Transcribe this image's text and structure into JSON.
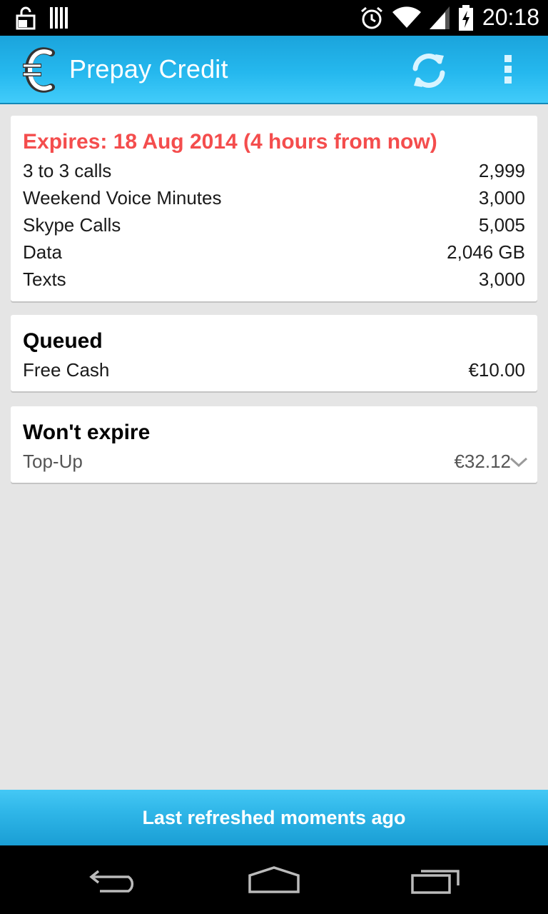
{
  "status_bar": {
    "time": "20:18",
    "icons": [
      "lock-icon",
      "barcode-icon",
      "alarm-icon",
      "wifi-icon",
      "signal-icon",
      "battery-charging-icon"
    ]
  },
  "action_bar": {
    "title": "Prepay Credit",
    "app_icon": "euro-logo-icon",
    "actions": [
      "refresh-icon",
      "overflow-menu-icon"
    ]
  },
  "expiring_card": {
    "expires_label": "Expires: 18 Aug 2014 (4 hours from now)",
    "rows": [
      {
        "label": "3 to 3 calls",
        "value": "2,999"
      },
      {
        "label": "Weekend Voice Minutes",
        "value": "3,000"
      },
      {
        "label": "Skype Calls",
        "value": "5,005"
      },
      {
        "label": "Data",
        "value": "2,046 GB"
      },
      {
        "label": "Texts",
        "value": "3,000"
      }
    ]
  },
  "queued_card": {
    "heading": "Queued",
    "rows": [
      {
        "label": "Free Cash",
        "value": "€10.00"
      }
    ]
  },
  "wont_expire_card": {
    "heading": "Won't expire",
    "rows": [
      {
        "label": "Top-Up",
        "value": "€32.12"
      }
    ]
  },
  "footer": {
    "text": "Last refreshed moments ago"
  },
  "nav_bar": {
    "buttons": [
      "back-icon",
      "home-icon",
      "recent-apps-icon"
    ]
  },
  "colors": {
    "accent": "#25b8ee",
    "expires_text": "#f44d4d",
    "background": "#e5e5e5"
  }
}
